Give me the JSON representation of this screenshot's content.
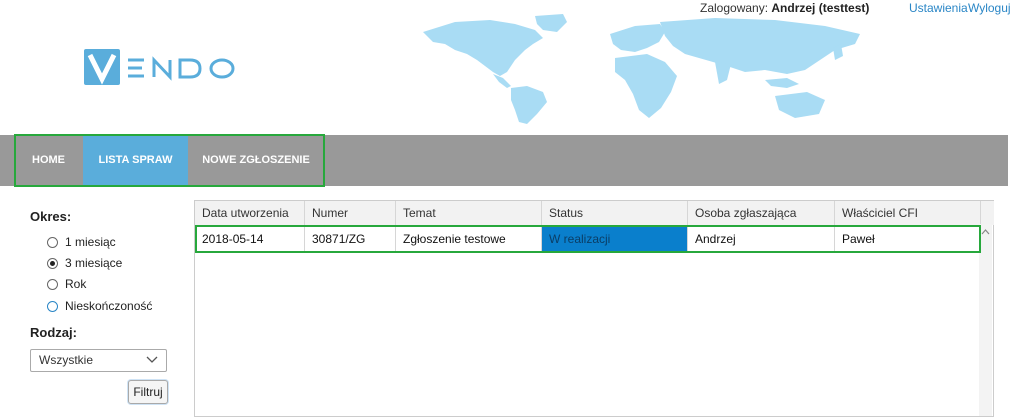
{
  "header": {
    "logo_text": "VENDO",
    "logged_in_label": "Zalogowany:",
    "user_name": "Andrzej (testtest)",
    "settings_link": "Ustawienia",
    "logout_link": "Wyloguj"
  },
  "nav": {
    "items": [
      {
        "label": "HOME",
        "active": false
      },
      {
        "label": "LISTA SPRAW",
        "active": true
      },
      {
        "label": "NOWE ZGŁOSZENIE",
        "active": false
      }
    ]
  },
  "sidebar": {
    "period_label": "Okres:",
    "period_options": [
      {
        "label": "1 miesiąc",
        "checked": false
      },
      {
        "label": "3 miesiące",
        "checked": true
      },
      {
        "label": "Rok",
        "checked": false
      },
      {
        "label": "Nieskończoność",
        "checked": false
      }
    ],
    "type_label": "Rodzaj:",
    "type_selected": "Wszystkie",
    "filter_button": "Filtruj"
  },
  "table": {
    "columns": [
      "Data utworzenia",
      "Numer",
      "Temat",
      "Status",
      "Osoba zgłaszająca",
      "Właściciel CFI"
    ],
    "rows": [
      [
        "2018-05-14",
        "30871/ZG",
        "Zgłoszenie testowe",
        "W realizacji",
        "Andrzej",
        "Paweł"
      ]
    ]
  },
  "colors": {
    "accent": "#5aaddb",
    "nav_bg": "#999999",
    "highlight_border": "#27a83c",
    "status_bg": "#0a7fcc",
    "map": "#a9dcf4"
  }
}
